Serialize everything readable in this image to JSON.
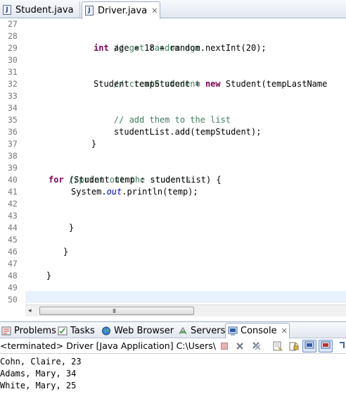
{
  "editor_tabs": [
    {
      "label": "Student.java",
      "icon": "java-file-icon",
      "active": false
    },
    {
      "label": "Driver.java",
      "icon": "java-file-icon",
      "active": true,
      "close": "✕"
    }
  ],
  "line_numbers": [
    "27",
    "28",
    "29",
    "30",
    "31",
    "32",
    "33",
    "34",
    "35",
    "36",
    "37",
    "38",
    "39",
    "40",
    "41",
    "42",
    "43",
    "44",
    "45",
    "46",
    "47",
    "48",
    "49",
    "50"
  ],
  "code": {
    "l28_comment": "// get random age",
    "l29_kw": "int",
    "l29_rest": " age = 18 + random.nextInt(20);",
    "l31_comment": "// create student",
    "l32_a": "Student tempStudent = ",
    "l32_kw": "new",
    "l32_b": " Student(tempLastName",
    "l34_comment": "// add them to the list",
    "l35": "studentList.add(tempStudent);",
    "l36": "}",
    "l39_comment": "//print out the students",
    "l40_kw": "for",
    "l40_rest": " (Student temp : studentList) {",
    "l41_a": "System.",
    "l41_field": "out",
    "l41_b": ".println(temp);",
    "l43": "}",
    "l45": "}",
    "l47": "}"
  },
  "scrollbar": {
    "left_arrow": "◂",
    "right_arrow": "▸",
    "grip": "III"
  },
  "view_tabs": [
    {
      "label": "Problems",
      "icon": "problems-icon"
    },
    {
      "label": "Tasks",
      "icon": "tasks-icon"
    },
    {
      "label": "Web Browser",
      "icon": "globe-icon"
    },
    {
      "label": "Servers",
      "icon": "servers-icon"
    },
    {
      "label": "Console",
      "icon": "console-icon",
      "active": true,
      "close": "✕"
    }
  ],
  "console_status": "<terminated> Driver [Java Application] C:\\Users\\Adm",
  "console_output": [
    "Cohn, Claire, 23",
    "Adams, Mary, 34",
    "White, Mary, 25"
  ],
  "colors": {
    "keyword": "#7f0055",
    "comment": "#3f7f5f",
    "field": "#0000c0",
    "current_line": "#e8f2fe"
  }
}
